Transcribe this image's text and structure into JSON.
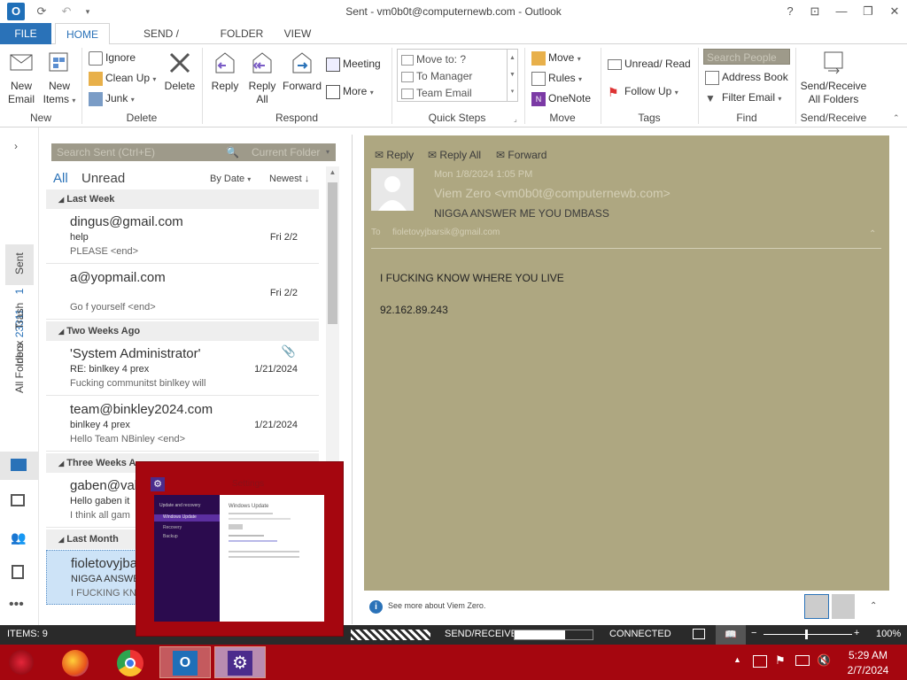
{
  "window": {
    "title": "Sent - vm0b0t@computernewb.com - Outlook",
    "help": "?",
    "min": "—",
    "restore": "❐",
    "close": "✕"
  },
  "tabs": {
    "file": "FILE",
    "home": "HOME",
    "send_receive": "SEND / RECEIVE",
    "folder": "FOLDER",
    "view": "VIEW"
  },
  "ribbon": {
    "new": {
      "new_email_1": "New",
      "new_email_2": "Email",
      "new_items_1": "New",
      "new_items_2": "Items",
      "label": "New"
    },
    "delete": {
      "ignore": "Ignore",
      "clean_up": "Clean Up",
      "junk": "Junk",
      "delete": "Delete",
      "label": "Delete"
    },
    "respond": {
      "reply": "Reply",
      "reply_all_1": "Reply",
      "reply_all_2": "All",
      "forward": "Forward",
      "meeting": "Meeting",
      "more": "More",
      "label": "Respond"
    },
    "quick_steps": {
      "items": [
        "Move to: ?",
        "To Manager",
        "Team Email"
      ],
      "label": "Quick Steps"
    },
    "move": {
      "move": "Move",
      "rules": "Rules",
      "onenote": "OneNote",
      "label": "Move"
    },
    "tags": {
      "unread_read": "Unread/ Read",
      "follow_up": "Follow Up",
      "label": "Tags"
    },
    "find": {
      "search_people": "Search People",
      "address_book": "Address Book",
      "filter_email": "Filter Email",
      "label": "Find"
    },
    "send_receive": {
      "line1": "Send/Receive",
      "line2": "All Folders",
      "label": "Send/Receive"
    }
  },
  "leftnav": {
    "inbox": "Inbox",
    "inbox_count": "23311",
    "sent": "Sent",
    "trash": "Trash",
    "trash_count": "1",
    "all_folders": "All Folders"
  },
  "list": {
    "search_placeholder": "Search Sent (Ctrl+E)",
    "scope": "Current Folder",
    "filter_all": "All",
    "filter_unread": "Unread",
    "sort_by": "By Date",
    "sort_order": "Newest",
    "groups": {
      "last_week": "Last Week",
      "two_weeks_ago": "Two Weeks Ago",
      "three_weeks_ago": "Three Weeks A",
      "last_month": "Last Month"
    },
    "items": [
      {
        "from": "dingus@gmail.com",
        "subject": "help",
        "preview": "PLEASE <end>",
        "date": "Fri 2/2"
      },
      {
        "from": "a@yopmail.com",
        "subject": "",
        "preview": "Go f yourself <end>",
        "date": "Fri 2/2"
      },
      {
        "from": "'System Administrator'",
        "subject": "RE: binlkey 4 prex",
        "preview": "Fucking communitst binlkey will",
        "date": "1/21/2024"
      },
      {
        "from": "team@binkley2024.com",
        "subject": "binlkey 4 prex",
        "preview": "Hello Team NBinley <end>",
        "date": "1/21/2024"
      },
      {
        "from": "gaben@val",
        "subject": "Hello gaben it",
        "preview": "I think all gam",
        "date": ""
      },
      {
        "from": "fioletovyjba",
        "subject": "NIGGA ANSWE",
        "preview": "I FUCKING KNO",
        "date": ""
      }
    ]
  },
  "reading": {
    "reply": "Reply",
    "reply_all": "Reply All",
    "forward": "Forward",
    "date": "Mon 1/8/2024 1:05 PM",
    "sender": "Viem Zero <vm0b0t@computernewb.com>",
    "subject": "NIGGA ANSWER ME YOU DMBASS",
    "to_label": "To",
    "to": "fioletovyjbarsik@gmail.com",
    "body_line1": "I FUCKING KNOW  WHERE YOU LIVE",
    "body_line2": "92.162.89.243",
    "people_info": "See more about Viem Zero."
  },
  "status": {
    "items": "ITEMS: 9",
    "send_receive": "SEND/RECEIVE",
    "send_receive_progress": 0.65,
    "connected": "CONNECTED",
    "zoom": "100%"
  },
  "popup": {
    "caption": "Settings",
    "sidebar_header": "Update and recovery",
    "sidebar_items": [
      "Windows Update",
      "Recovery",
      "Backup"
    ],
    "content_title": "Windows Update"
  },
  "taskbar": {
    "time": "5:29 AM",
    "date": "2/7/2024"
  },
  "colors": {
    "accent": "#2a72b8",
    "reading_bg": "#aea781",
    "taskbar": "#a5060f",
    "status_bg": "#2a2a2a"
  }
}
